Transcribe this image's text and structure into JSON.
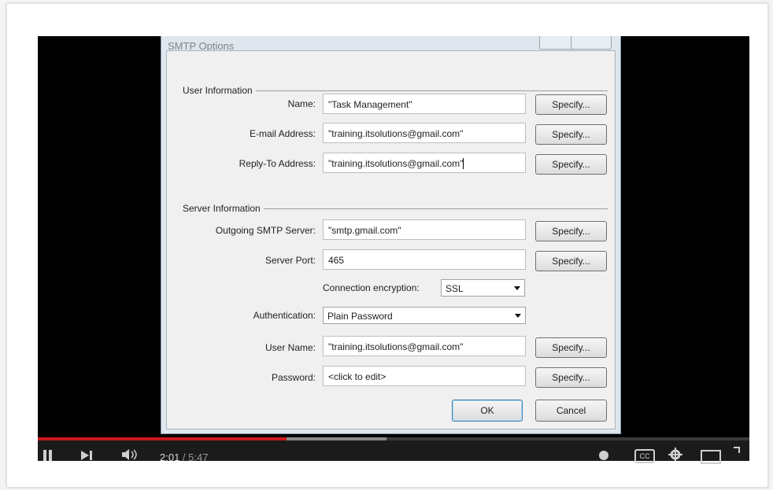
{
  "dialog": {
    "title": "SMTP Options",
    "user_info_title": "User Information",
    "server_info_title": "Server Information",
    "specify_label": "Specify...",
    "fields": {
      "name": {
        "label": "Name:",
        "value": "\"Task Management\""
      },
      "email": {
        "label": "E-mail Address:",
        "value": "\"training.itsolutions@gmail.com\""
      },
      "reply_to": {
        "label": "Reply-To Address:",
        "value": "\"training.itsolutions@gmail.com\""
      },
      "smtp_server": {
        "label": "Outgoing SMTP Server:",
        "value": "\"smtp.gmail.com\""
      },
      "port": {
        "label": "Server Port:",
        "value": "465"
      },
      "encryption": {
        "label": "Connection encryption:",
        "value": "SSL"
      },
      "authentication": {
        "label": "Authentication:",
        "value": "Plain Password"
      },
      "user_name": {
        "label": "User Name:",
        "value": "\"training.itsolutions@gmail.com\""
      },
      "password": {
        "label": "Password:",
        "value": "<click to edit>"
      }
    },
    "ok_label": "OK",
    "cancel_label": "Cancel"
  },
  "player": {
    "current_time": "2:01",
    "duration": " / 5:47",
    "played_fraction": 0.35,
    "buffered_fraction": 0.49,
    "cc_label": "CC"
  },
  "colors": {
    "progress_played": "#cc181e",
    "primary_button_border": "#3c7fb1"
  }
}
